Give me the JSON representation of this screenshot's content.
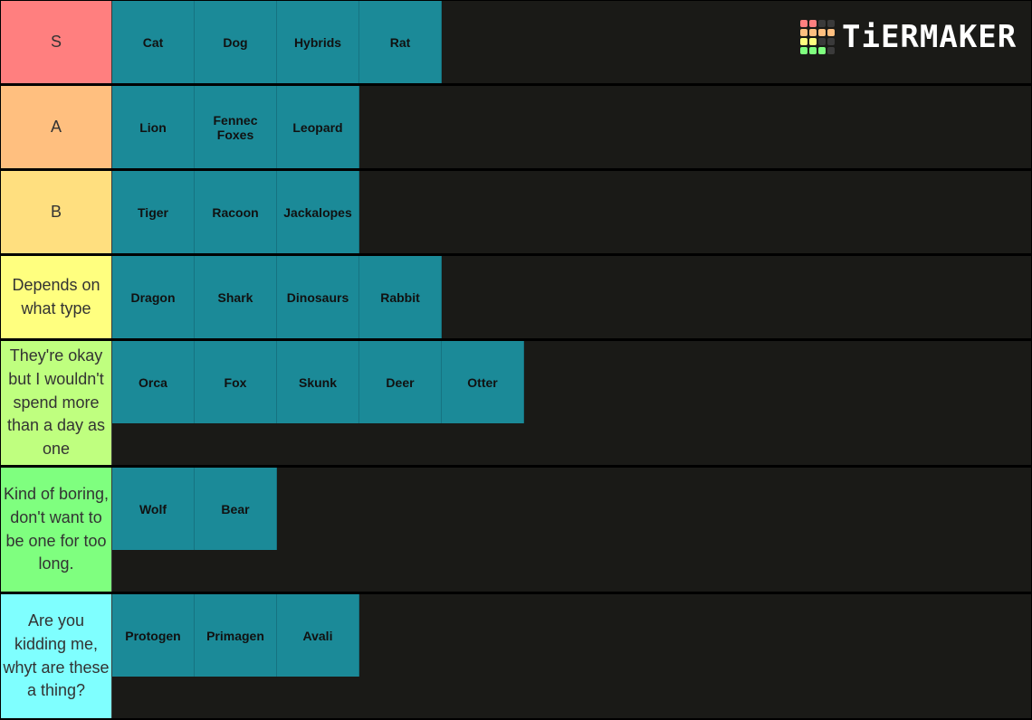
{
  "logo": {
    "text": "TiERMAKER",
    "grid_colors": [
      "#ff7f7f",
      "#ff7f7f",
      "#3a3a3a",
      "#3a3a3a",
      "#ffbf7f",
      "#ffbf7f",
      "#ffbf7f",
      "#ffbf7f",
      "#ffff7f",
      "#ffff7f",
      "#3a3a3a",
      "#3a3a3a",
      "#7fff7f",
      "#7fff7f",
      "#7fff7f",
      "#3a3a3a"
    ]
  },
  "colors": {
    "item_bg": "#1b8a98",
    "row_bg": "#1a1a17"
  },
  "tiers": [
    {
      "label": "S",
      "color": "#ff7f7f",
      "items": [
        "Cat",
        "Dog",
        "Hybrids",
        "Rat"
      ]
    },
    {
      "label": "A",
      "color": "#ffbf7f",
      "items": [
        "Lion",
        "Fennec Foxes",
        "Leopard"
      ]
    },
    {
      "label": "B",
      "color": "#ffdf7f",
      "items": [
        "Tiger",
        "Racoon",
        "Jackalopes"
      ]
    },
    {
      "label": "Depends on what type",
      "color": "#ffff7f",
      "items": [
        "Dragon",
        "Shark",
        "Dinosaurs",
        "Rabbit"
      ]
    },
    {
      "label": "They're okay but I wouldn't spend more than a day as one",
      "color": "#bfff7f",
      "items": [
        "Orca",
        "Fox",
        "Skunk",
        "Deer",
        "Otter"
      ]
    },
    {
      "label": "Kind of boring, don't want to be one for too long.",
      "color": "#7fff7f",
      "items": [
        "Wolf",
        "Bear"
      ]
    },
    {
      "label": "Are you kidding me, whyt are these a thing?",
      "color": "#7fffff",
      "items": [
        "Protogen",
        "Primagen",
        "Avali"
      ]
    }
  ]
}
